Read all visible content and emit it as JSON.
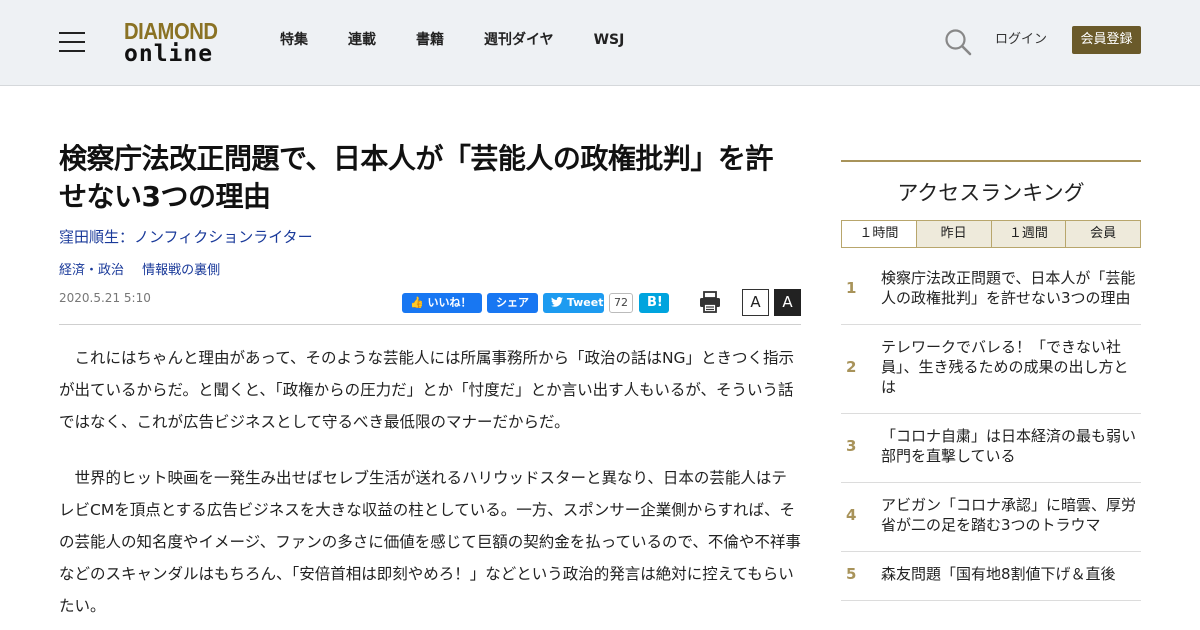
{
  "header": {
    "logo_top": "DIAMOND",
    "logo_bottom": "online",
    "nav": [
      "特集",
      "連載",
      "書籍",
      "週刊ダイヤ",
      "WSJ"
    ],
    "login": "ログイン",
    "register": "会員登録"
  },
  "article": {
    "title": "検察庁法改正問題で、日本人が「芸能人の政権批判」を許せない3つの理由",
    "author": "窪田順生：ノンフィクションライター",
    "categories": [
      "経済・政治",
      "情報戦の裏側"
    ],
    "date": "2020.5.21 5:10",
    "share": {
      "like": "いいね！",
      "share": "シェア",
      "tweet": "Tweet",
      "tweet_count": "72",
      "hatena": "B!"
    },
    "font_small": "A",
    "font_large": "A",
    "paragraphs": [
      "これにはちゃんと理由があって、そのような芸能人には所属事務所から「政治の話はNG」ときつく指示が出ているからだ。と聞くと、「政権からの圧力だ」とか「忖度だ」とか言い出す人もいるが、そういう話ではなく、これが広告ビジネスとして守るべき最低限のマナーだからだ。",
      "世界的ヒット映画を一発生み出せばセレブ生活が送れるハリウッドスターと異なり、日本の芸能人はテレビCMを頂点とする広告ビジネスを大きな収益の柱としている。一方、スポンサー企業側からすれば、その芸能人の知名度やイメージ、ファンの多さに価値を感じて巨額の契約金を払っているので、不倫や不祥事などのスキャンダルはもちろん、「安倍首相は即刻やめろ！」などという政治的発言は絶対に控えてもらいたい。"
    ]
  },
  "ranking": {
    "title": "アクセスランキング",
    "tabs": [
      "１時間",
      "昨日",
      "１週間",
      "会員"
    ],
    "items": [
      {
        "rank": "1",
        "title": "検察庁法改正問題で、日本人が「芸能人の政権批判」を許せない3つの理由"
      },
      {
        "rank": "2",
        "title": "テレワークでバレる！「できない社員」、生き残るための成果の出し方とは"
      },
      {
        "rank": "3",
        "title": "「コロナ自粛」は日本経済の最も弱い部門を直撃している"
      },
      {
        "rank": "4",
        "title": "アビガン「コロナ承認」に暗雲、厚労省が二の足を踏む3つのトラウマ"
      },
      {
        "rank": "5",
        "title": "森友問題「国有地8割値下げ＆直後"
      }
    ]
  },
  "colors": {
    "header_bg": "#eef1f4",
    "logo_gold": "#8a7224",
    "register_bg": "#6a5a2a",
    "link_blue": "#1a3a9a",
    "rank_gold": "#a8935a"
  }
}
